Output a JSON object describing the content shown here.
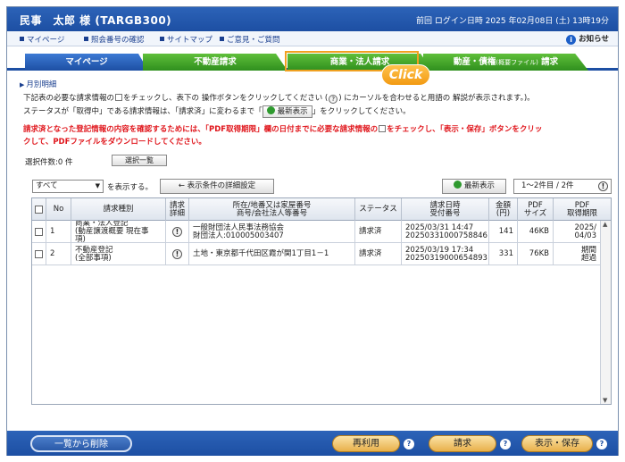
{
  "header": {
    "user_name": "民事　太郎 様 (TARGB300)",
    "last_login": "前回 ログイン日時 2025 年02月08日 (土) 13時19分"
  },
  "links": [
    "マイページ",
    "照会番号の確認",
    "サイトマップ",
    "ご意見・ご質問"
  ],
  "notice": "お知らせ",
  "tabs": [
    {
      "label": "マイページ"
    },
    {
      "label": "不動産請求"
    },
    {
      "label": "商業・法人請求"
    },
    {
      "label": "動産・債権",
      "sub": "(概要ファイル)",
      "tail": " 請求"
    }
  ],
  "click_label": "Click",
  "monthly_link": "月別明細",
  "info": {
    "line1_a": "下記表の必要な請求情報の",
    "line1_b": "をチェックし、表下の 操作ボタンをクリックしてください (",
    "line1_c": ") にカーソルを合わせると用語の 解説が表示されます。)。",
    "line2_a": "ステータスが「取得中」である請求情報は、「請求済」に変わるまで「",
    "line2_btn": "最新表示",
    "line2_b": "」をクリックしてください。",
    "red1_a": "請求済となった登記情報の内容を確認するためには、「PDF取得期限」欄の日付までに必要な請求情報の",
    "red1_b": "をチェックし、「表示・保存」ボタンをクリッ",
    "red2": "クして、PDFファイルをダウンロードしてください。"
  },
  "selection": {
    "count_label": "選択件数:0 件",
    "list_button": "選択一覧"
  },
  "filter": {
    "value": "すべて",
    "suffix": "を表示する。",
    "detail_button": "← 表示条件の詳細設定",
    "refresh_button": "最新表示",
    "pager": "1～2件目 / 2件"
  },
  "table": {
    "headers": [
      "No",
      "請求種別",
      "請求\n詳細",
      "所在/地番又は家屋番号\n商号/会社法人等番号",
      "ステータス",
      "請求日時\n受付番号",
      "金額\n(円)",
      "PDF\nサイズ",
      "PDF\n取得期限"
    ],
    "rows": [
      {
        "no": "1",
        "type": "商業・法人登記\n(動産譲渡概要 現在事\n項)",
        "detail": "!",
        "location": "一般財団法人民事法務協会\n財団法人:010005003407",
        "status": "請求済",
        "date": "2025/03/31 14:47\n20250331000758846",
        "amount": "141",
        "size": "46KB",
        "deadline": "2025/\n04/03"
      },
      {
        "no": "2",
        "type": "不動産登記\n(全部事項)",
        "detail": "!",
        "location": "土地・東京都千代田区霞が関1丁目1－1",
        "status": "請求済",
        "date": "2025/03/19 17:34\n20250319000654893",
        "amount": "331",
        "size": "76KB",
        "deadline": "期間\n超過"
      }
    ]
  },
  "footer": {
    "delete": "一覧から削除",
    "reuse": "再利用",
    "request": "請求",
    "view_save": "表示・保存"
  }
}
